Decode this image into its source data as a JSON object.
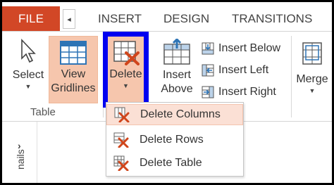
{
  "tabs": {
    "file": "FILE",
    "scroll_left": "◂",
    "insert": "INSERT",
    "design": "DESIGN",
    "transitions": "TRANSITIONS"
  },
  "ribbon": {
    "select_label": "Select",
    "view_gridlines_line1": "View",
    "view_gridlines_line2": "Gridlines",
    "delete_label": "Delete",
    "insert_above_line1": "Insert",
    "insert_above_line2": "Above",
    "insert_below": "Insert Below",
    "insert_left": "Insert Left",
    "insert_right": "Insert Right",
    "merge_label": "Merge",
    "table_group": "Table",
    "caret": "▼"
  },
  "delete_menu": {
    "items": [
      {
        "label": "Delete Columns",
        "icon": "delete-columns-icon",
        "hovered": true
      },
      {
        "label": "Delete Rows",
        "icon": "delete-rows-icon",
        "hovered": false
      },
      {
        "label": "Delete Table",
        "icon": "delete-table-icon",
        "hovered": false
      }
    ]
  },
  "left_pane": {
    "chevron": "›",
    "label": "nails"
  },
  "colors": {
    "file_tab": "#d24726",
    "selected_bg": "#f6c6ad",
    "highlight_box": "#0000f0",
    "delete_x": "#d0451b",
    "grid_blue": "#2e74b5"
  }
}
